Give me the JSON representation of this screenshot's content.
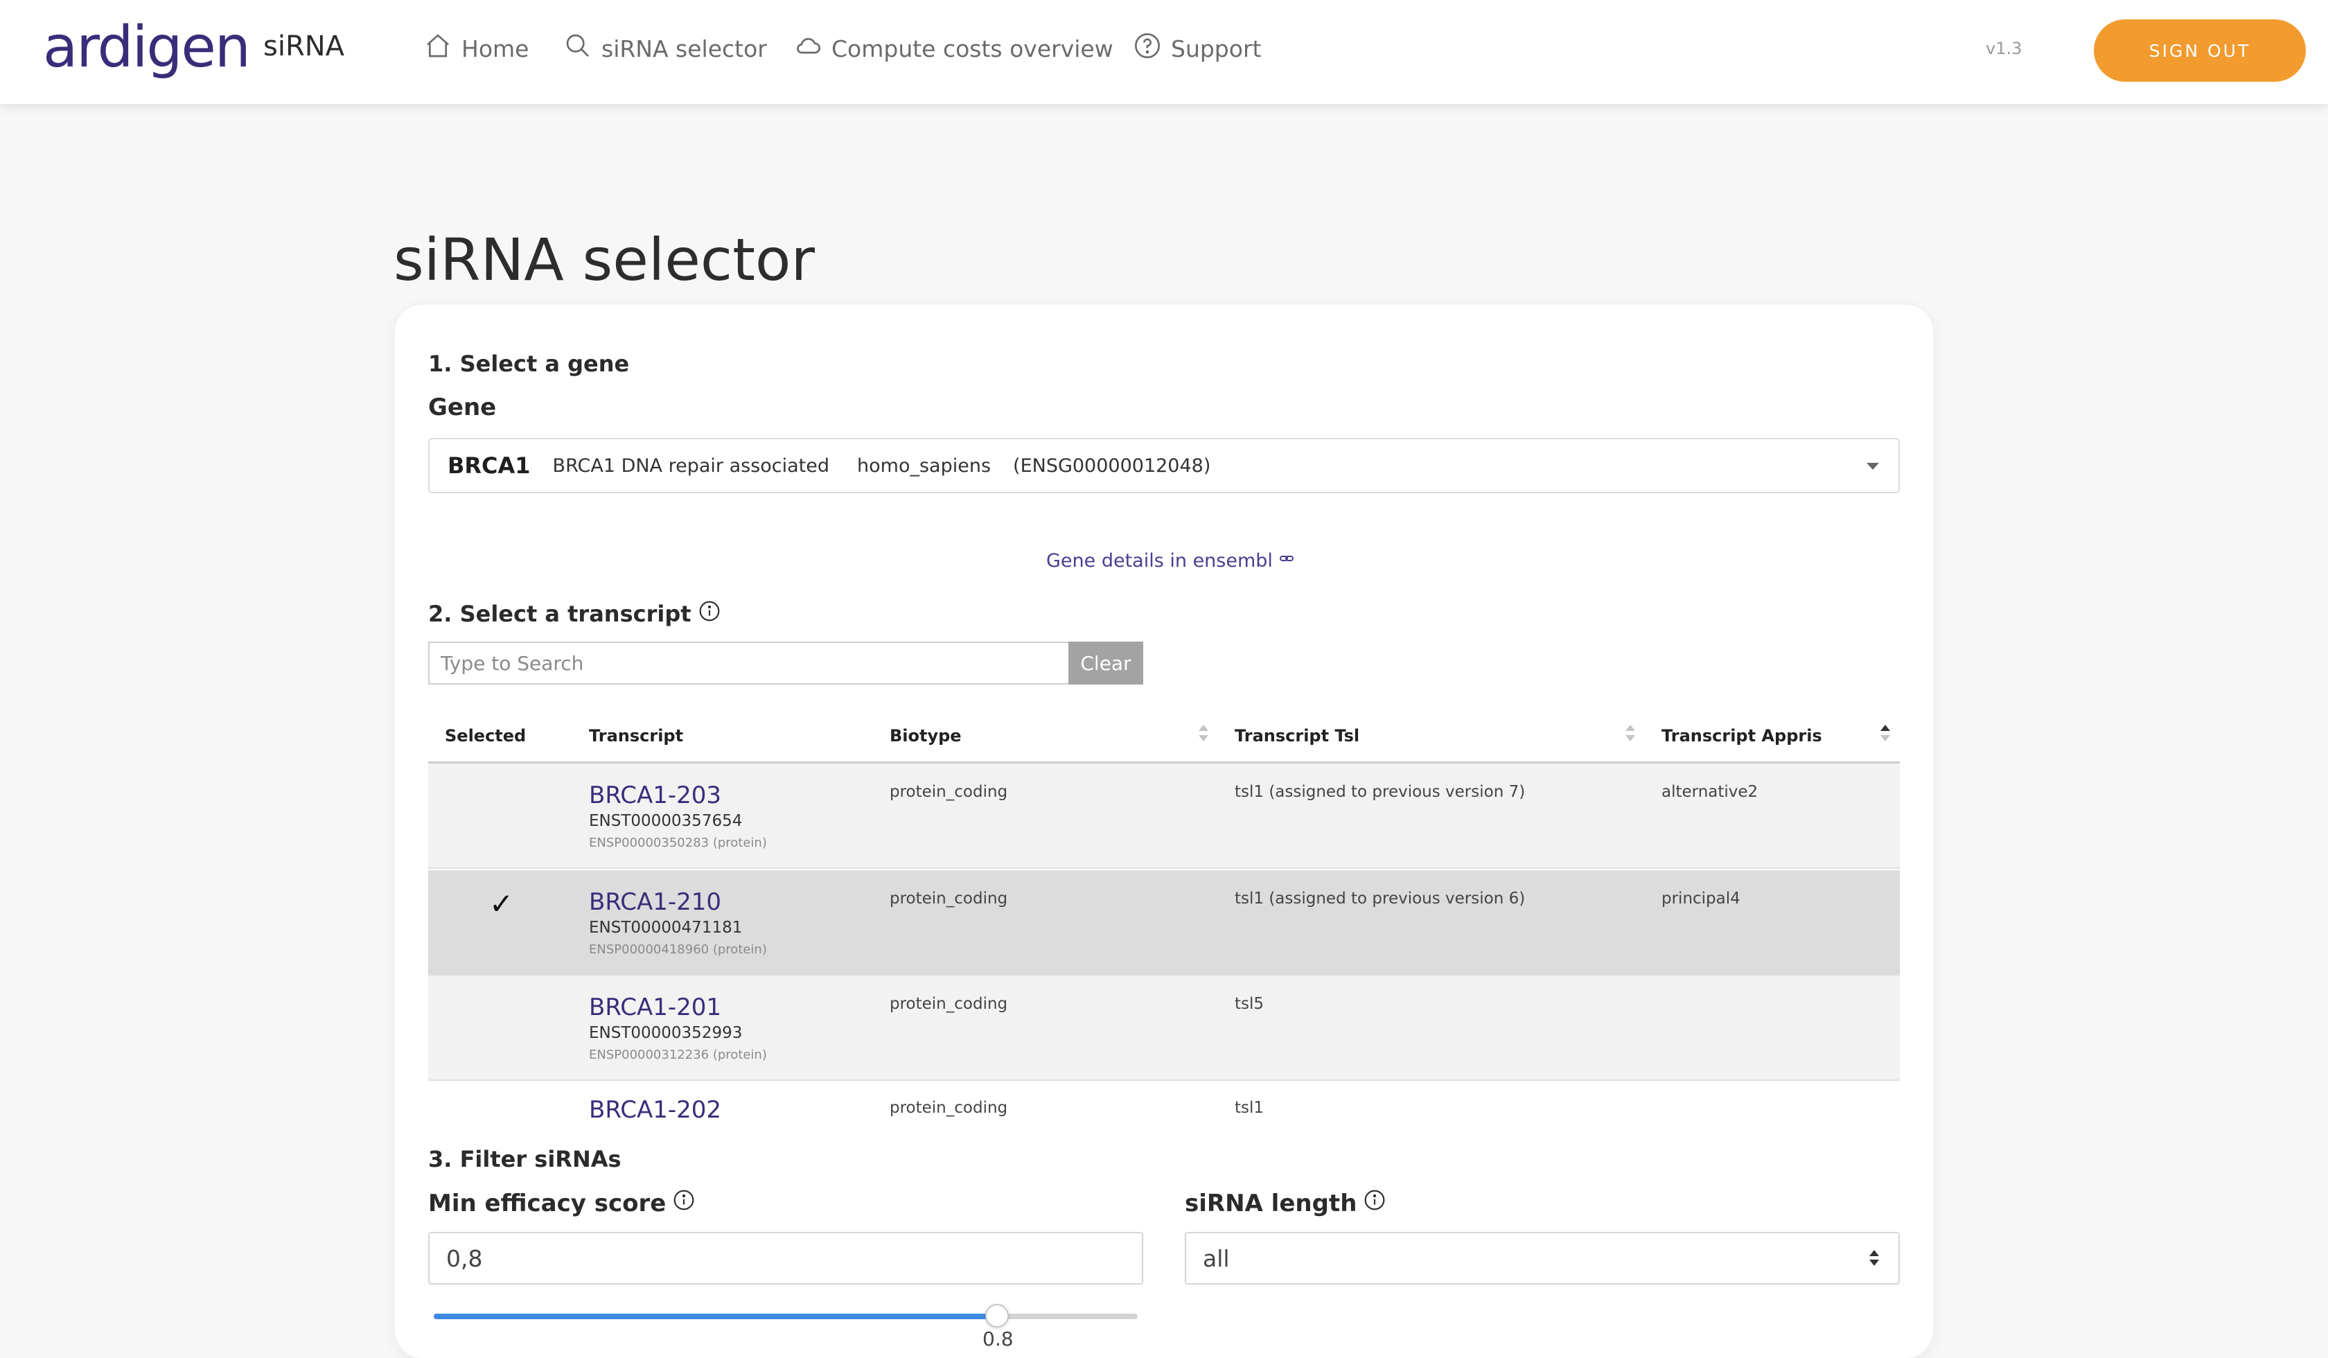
{
  "header": {
    "logo": "ardigen",
    "product": "siRNA",
    "nav": [
      {
        "label": "Home",
        "icon": "home-icon"
      },
      {
        "label": "siRNA selector",
        "icon": "search-icon"
      },
      {
        "label": "Compute costs overview",
        "icon": "cloud-icon"
      },
      {
        "label": "Support",
        "icon": "help-circle-icon"
      }
    ],
    "version": "v1.3",
    "signout_label": "SIGN OUT",
    "accent_color": "#f29b2f",
    "brand_color": "#3b2c7a"
  },
  "page": {
    "title": "siRNA selector"
  },
  "gene_section": {
    "heading": "1. Select a gene",
    "label": "Gene",
    "selected": {
      "symbol": "BRCA1",
      "description": "BRCA1 DNA repair associated",
      "species": "homo_sapiens",
      "ensembl_id": "(ENSG00000012048)"
    },
    "details_link": "Gene details in ensembl"
  },
  "transcript_section": {
    "heading": "2. Select a transcript",
    "search_placeholder": "Type to Search",
    "clear_label": "Clear",
    "columns": {
      "selected": "Selected",
      "transcript": "Transcript",
      "biotype": "Biotype",
      "tsl": "Transcript Tsl",
      "appris": "Transcript Appris"
    },
    "rows": [
      {
        "name": "BRCA1-203",
        "enst": "ENST00000357654",
        "ensp": "ENSP00000350283 (protein)",
        "biotype": "protein_coding",
        "tsl": "tsl1 (assigned to previous version 7)",
        "appris": "alternative2",
        "selected": ""
      },
      {
        "name": "BRCA1-210",
        "enst": "ENST00000471181",
        "ensp": "ENSP00000418960 (protein)",
        "biotype": "protein_coding",
        "tsl": "tsl1 (assigned to previous version 6)",
        "appris": "principal4",
        "selected": "✓"
      },
      {
        "name": "BRCA1-201",
        "enst": "ENST00000352993",
        "ensp": "ENSP00000312236 (protein)",
        "biotype": "protein_coding",
        "tsl": "tsl5",
        "appris": "",
        "selected": ""
      },
      {
        "name": "BRCA1-202",
        "enst": "",
        "ensp": "",
        "biotype": "protein_coding",
        "tsl": "tsl1",
        "appris": "",
        "selected": ""
      }
    ]
  },
  "filter_section": {
    "heading": "3. Filter siRNAs",
    "min_score_label": "Min efficacy score",
    "min_score_value": "0,8",
    "min_score_fraction": 0.8,
    "slider_value_label": "0.8",
    "length_label": "siRNA length",
    "length_value": "all"
  }
}
